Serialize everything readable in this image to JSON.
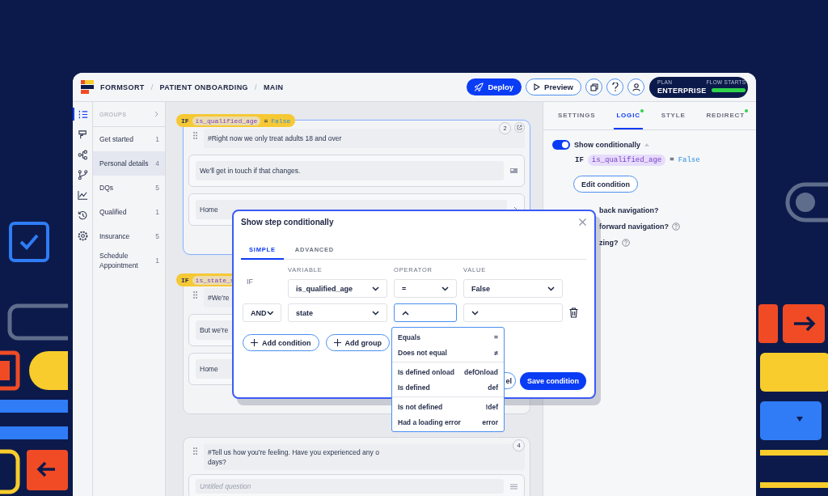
{
  "topbar": {
    "brand": "FORMSORT",
    "breadcrumbs": [
      {
        "separator": "/",
        "label": "PATIENT ONBOARDING"
      },
      {
        "separator": "/",
        "label": "MAIN"
      }
    ],
    "deploy": "Deploy",
    "preview": "Preview",
    "plan": {
      "label": "PLAN",
      "name": "ENTERPRISE",
      "meter_label": "FLOW STARTS",
      "level": 1
    }
  },
  "rail": [
    {
      "selected": true
    },
    {
      "selected": false
    },
    {
      "selected": false
    },
    {
      "selected": false
    },
    {
      "selected": false
    },
    {
      "selected": false
    },
    {
      "selected": false
    }
  ],
  "groups": {
    "title": "GROUPS",
    "items": [
      {
        "label": "Get started",
        "count": "1",
        "selected": false
      },
      {
        "label": "Personal details",
        "count": "4",
        "selected": true
      },
      {
        "label": "DQs",
        "count": "5",
        "selected": false
      },
      {
        "label": "Qualified",
        "count": "1",
        "selected": false
      },
      {
        "label": "Insurance",
        "count": "5",
        "selected": false
      },
      {
        "label": "Schedule Appointment",
        "count": "1",
        "selected": false
      }
    ]
  },
  "steps": [
    {
      "selected": true,
      "number": "2",
      "external_link": true,
      "condition": {
        "keyword": "IF",
        "variable": "is_qualified_age",
        "operator": "=",
        "value": "False"
      },
      "heading": "#Right now we only treat adults 18 and over",
      "questions": [
        {
          "kind": "info",
          "text": "We'll get in touch if that changes."
        },
        {
          "kind": "link",
          "text": "Home"
        }
      ]
    },
    {
      "selected": false,
      "condition": {
        "keyword": "IF",
        "variable": "is_state_s"
      },
      "heading": "#We're",
      "questions": [
        {
          "kind": "text",
          "text": "But we're"
        },
        {
          "kind": "text",
          "text": "Home"
        }
      ]
    },
    {
      "selected": false,
      "number": "4",
      "external_link": false,
      "heading": "#Tell us how you're feeling. Have you experienced any o",
      "heading_line_2": "days?",
      "questions": [
        {
          "kind": "input",
          "placeholder": "Untitled question"
        }
      ]
    }
  ],
  "panel": {
    "tabs": [
      {
        "label": "SETTINGS",
        "selected": false,
        "modified": false
      },
      {
        "label": "LOGIC",
        "selected": true,
        "modified": true
      },
      {
        "label": "STYLE",
        "selected": false,
        "modified": false
      },
      {
        "label": "REDIRECT",
        "selected": false,
        "modified": true
      }
    ],
    "show_conditionally": {
      "label": "Show conditionally",
      "on": true,
      "expanded": true
    },
    "condition": {
      "keyword": "IF",
      "variable": "is_qualified_age",
      "operator": "=",
      "value": "False"
    },
    "edit_button": "Edit condition",
    "options": [
      {
        "text": "back navigation?",
        "help": false
      },
      {
        "text": "forward navigation?",
        "help": true
      },
      {
        "text": "zing?",
        "help": true
      }
    ]
  },
  "modal": {
    "title": "Show step conditionally",
    "tabs": [
      {
        "label": "SIMPLE",
        "selected": true
      },
      {
        "label": "ADVANCED",
        "selected": false
      }
    ],
    "columns": [
      "VARIABLE",
      "OPERATOR",
      "VALUE"
    ],
    "rows": [
      {
        "kind": "label",
        "connector": "IF",
        "variable": "is_qualified_age",
        "operator": "=",
        "value": "False",
        "open": false,
        "deletable": false
      },
      {
        "kind": "select",
        "connector": "AND",
        "variable": "state",
        "open": true,
        "deletable": true
      }
    ],
    "add_condition": "Add condition",
    "add_group": "Add group",
    "cancel": "el",
    "save": "Save condition",
    "operator_menu": [
      {
        "items": [
          {
            "label": "Equals",
            "symbol": "="
          },
          {
            "label": "Does not equal",
            "symbol": "≠"
          }
        ]
      },
      {
        "items": [
          {
            "label": "Is defined onload",
            "symbol": "defOnload"
          },
          {
            "label": "Is defined",
            "symbol": "def"
          }
        ]
      },
      {
        "items": [
          {
            "label": "Is not defined",
            "symbol": "!def"
          },
          {
            "label": "Had a loading error",
            "symbol": "error"
          }
        ]
      }
    ]
  }
}
